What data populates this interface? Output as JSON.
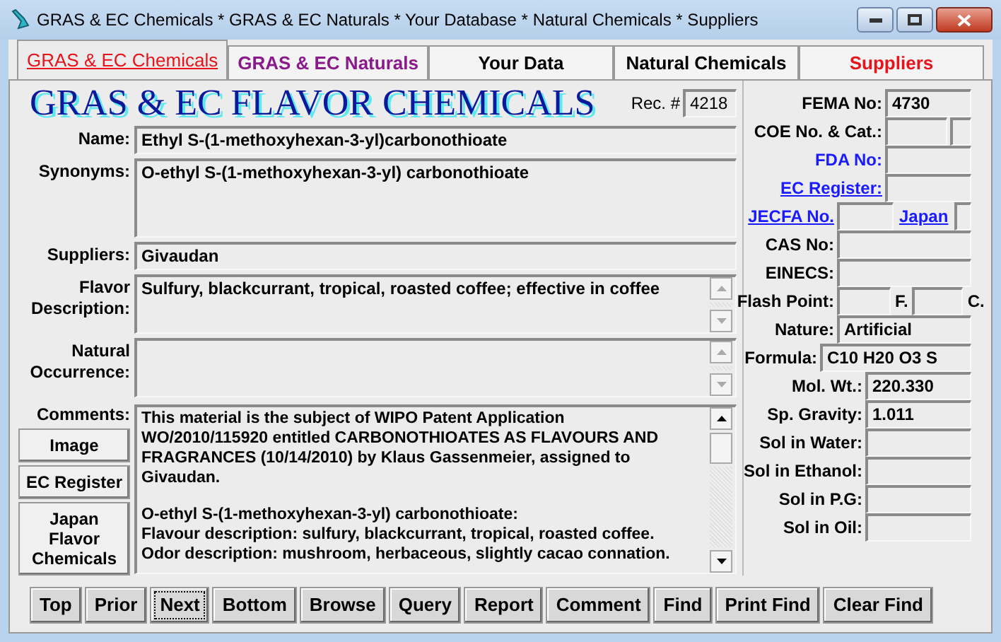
{
  "window": {
    "title": "GRAS & EC Chemicals * GRAS & EC Naturals * Your Database * Natural Chemicals * Suppliers"
  },
  "tabs": [
    {
      "label": "GRAS & EC Chemicals",
      "selected": true,
      "color": "#e8141c"
    },
    {
      "label": "GRAS & EC Naturals",
      "selected": false,
      "color": "#8a1a8a"
    },
    {
      "label": "Your Data",
      "selected": false,
      "color": "#000000"
    },
    {
      "label": "Natural Chemicals",
      "selected": false,
      "color": "#000000"
    },
    {
      "label": "Suppliers",
      "selected": false,
      "color": "#e8141c"
    }
  ],
  "heading": "GRAS & EC FLAVOR CHEMICALS",
  "record": {
    "label": "Rec. #",
    "value": "4218"
  },
  "fields": [
    {
      "kind": "line",
      "label": "Name:",
      "value": "Ethyl S-(1-methoxyhexan-3-yl)carbonothioate"
    },
    {
      "kind": "area",
      "label": "Synonyms:",
      "value": "O-ethyl S-(1-methoxyhexan-3-yl) carbonothioate"
    },
    {
      "kind": "line",
      "label": "Suppliers:",
      "value": "Givaudan"
    },
    {
      "kind": "scroll",
      "label": "Flavor Description:",
      "value": "Sulfury, blackcurrant, tropical, roasted coffee; effective in coffee"
    },
    {
      "kind": "scroll",
      "label": "Natural Occurrence:"
    }
  ],
  "comments": {
    "label": "Comments:",
    "paragraphs": [
      "This material is the subject of WIPO Patent Application WO/2010/115920 entitled CARBONOTHIOATES AS FLAVOURS AND FRAGRANCES (10/14/2010) by Klaus Gassenmeier, assigned to Givaudan.",
      "O-ethyl S-(1-methoxyhexan-3-yl) carbonothioate:\nFlavour description: sulfury, blackcurrant, tropical, roasted coffee.\nOdor description: mushroom, herbaceous, slightly cacao connation."
    ]
  },
  "side_buttons": [
    "Image",
    "EC Register",
    "Japan Flavor Chemicals"
  ],
  "properties": [
    {
      "kind": "field",
      "label": "FEMA No:",
      "link": false,
      "underlined": false,
      "value": "4730"
    },
    {
      "kind": "split",
      "label": "COE No. & Cat.:",
      "link": false,
      "underlined": false
    },
    {
      "kind": "field",
      "label": "FDA No:",
      "link": true,
      "underlined": false
    },
    {
      "kind": "field",
      "label": "EC Register:",
      "link": true,
      "underlined": true
    },
    {
      "kind": "pair",
      "label": "JECFA No.",
      "link": true,
      "underlined": true,
      "second_label": "Japan"
    },
    {
      "kind": "wide",
      "label": "CAS No:",
      "link": false,
      "underlined": false
    },
    {
      "kind": "wide",
      "label": "EINECS:",
      "link": false,
      "underlined": false
    },
    {
      "kind": "flash",
      "label": "Flash Point:",
      "link": false,
      "underlined": false,
      "unit_1": "F.",
      "unit_2": "C."
    },
    {
      "kind": "wide",
      "label": "Nature:",
      "link": false,
      "underlined": false,
      "value": "Artificial"
    },
    {
      "kind": "formula",
      "label": "Formula:",
      "link": false,
      "underlined": false,
      "value": "C10 H20 O3 S"
    },
    {
      "kind": "short",
      "label": "Mol. Wt.:",
      "link": false,
      "underlined": false,
      "value": "220.330"
    },
    {
      "kind": "short",
      "label": "Sp. Gravity:",
      "link": false,
      "underlined": false,
      "value": "1.011"
    },
    {
      "kind": "short",
      "label": "Sol in Water:",
      "link": false,
      "underlined": false
    },
    {
      "kind": "short",
      "label": "Sol in Ethanol:",
      "link": false,
      "underlined": false
    },
    {
      "kind": "short",
      "label": "Sol in P.G:",
      "link": false,
      "underlined": false
    },
    {
      "kind": "short",
      "label": "Sol in Oil:",
      "link": false,
      "underlined": false
    }
  ],
  "nav_buttons": [
    {
      "label": "Top",
      "focused": false
    },
    {
      "label": "Prior",
      "focused": false
    },
    {
      "label": "Next",
      "focused": true
    },
    {
      "label": "Bottom",
      "focused": false
    },
    {
      "label": "Browse",
      "focused": false
    },
    {
      "label": "Query",
      "focused": false
    },
    {
      "label": "Report",
      "focused": false
    },
    {
      "label": "Comment",
      "focused": false
    },
    {
      "label": "Find",
      "focused": false
    },
    {
      "label": "Print Find",
      "focused": false
    },
    {
      "label": "Clear Find",
      "focused": false
    }
  ]
}
